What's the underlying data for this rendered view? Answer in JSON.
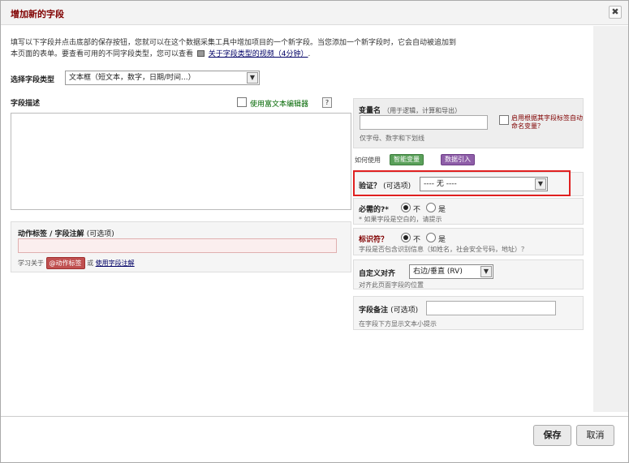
{
  "dialog": {
    "title": "增加新的字段",
    "close_glyph": "✖"
  },
  "intro": {
    "line1": "填写以下字段并点击底部的保存按钮，您就可以在这个数据采集工具中增加项目的一个新字段。当您添加一个新字段时，它会自动被追加到",
    "line2_prefix": "本页面的表单。要查看可用的不同字段类型，您可以查看",
    "video_link": "关于字段类型的视频（4分钟）",
    "line2_suffix": "."
  },
  "field_type": {
    "label": "选择字段类型",
    "selected": "文本框（短文本，数字，日期/时间...）"
  },
  "description": {
    "label": "字段描述",
    "rich_text_label": "使用富文本编辑器",
    "help": "?"
  },
  "action_tags": {
    "label": "动作标签 / 字段注解",
    "optional": "(可选项)",
    "learn_prefix": "学习关于",
    "badge": "@动作标签",
    "or": "或",
    "link": "使用字段注解"
  },
  "variable": {
    "label": "变量名",
    "hint": "（用于逻辑，计算和导出）",
    "note": "仅字母、数字和下划线",
    "auto_label": "启用根据其字段标签自动命名变量？"
  },
  "how_use": {
    "label": "如何使用",
    "smart_vars": "智能变量",
    "piping": "数据引入"
  },
  "validation": {
    "label": "验证？",
    "optional": "(可选项)",
    "selected": "---- 无 ----"
  },
  "required": {
    "label": "必需的?*",
    "no": "不",
    "yes": "是",
    "note": "* 如果字段是空白的，请提示"
  },
  "identifier": {
    "label": "标识符？",
    "no": "不",
    "yes": "是",
    "note": "字段是否包含识别信息（如姓名，社会安全号码，地址）？"
  },
  "alignment": {
    "label": "自定义对齐",
    "selected": "右边/垂直 (RV)",
    "note": "对齐此页面字段的位置"
  },
  "field_note": {
    "label": "字段备注",
    "optional": "(可选项)",
    "note": "在字段下方显示文本小提示"
  },
  "footer": {
    "save": "保存",
    "cancel": "取消"
  },
  "icons": {
    "dropdown": "chevron-down-icon",
    "video": "film-icon"
  }
}
